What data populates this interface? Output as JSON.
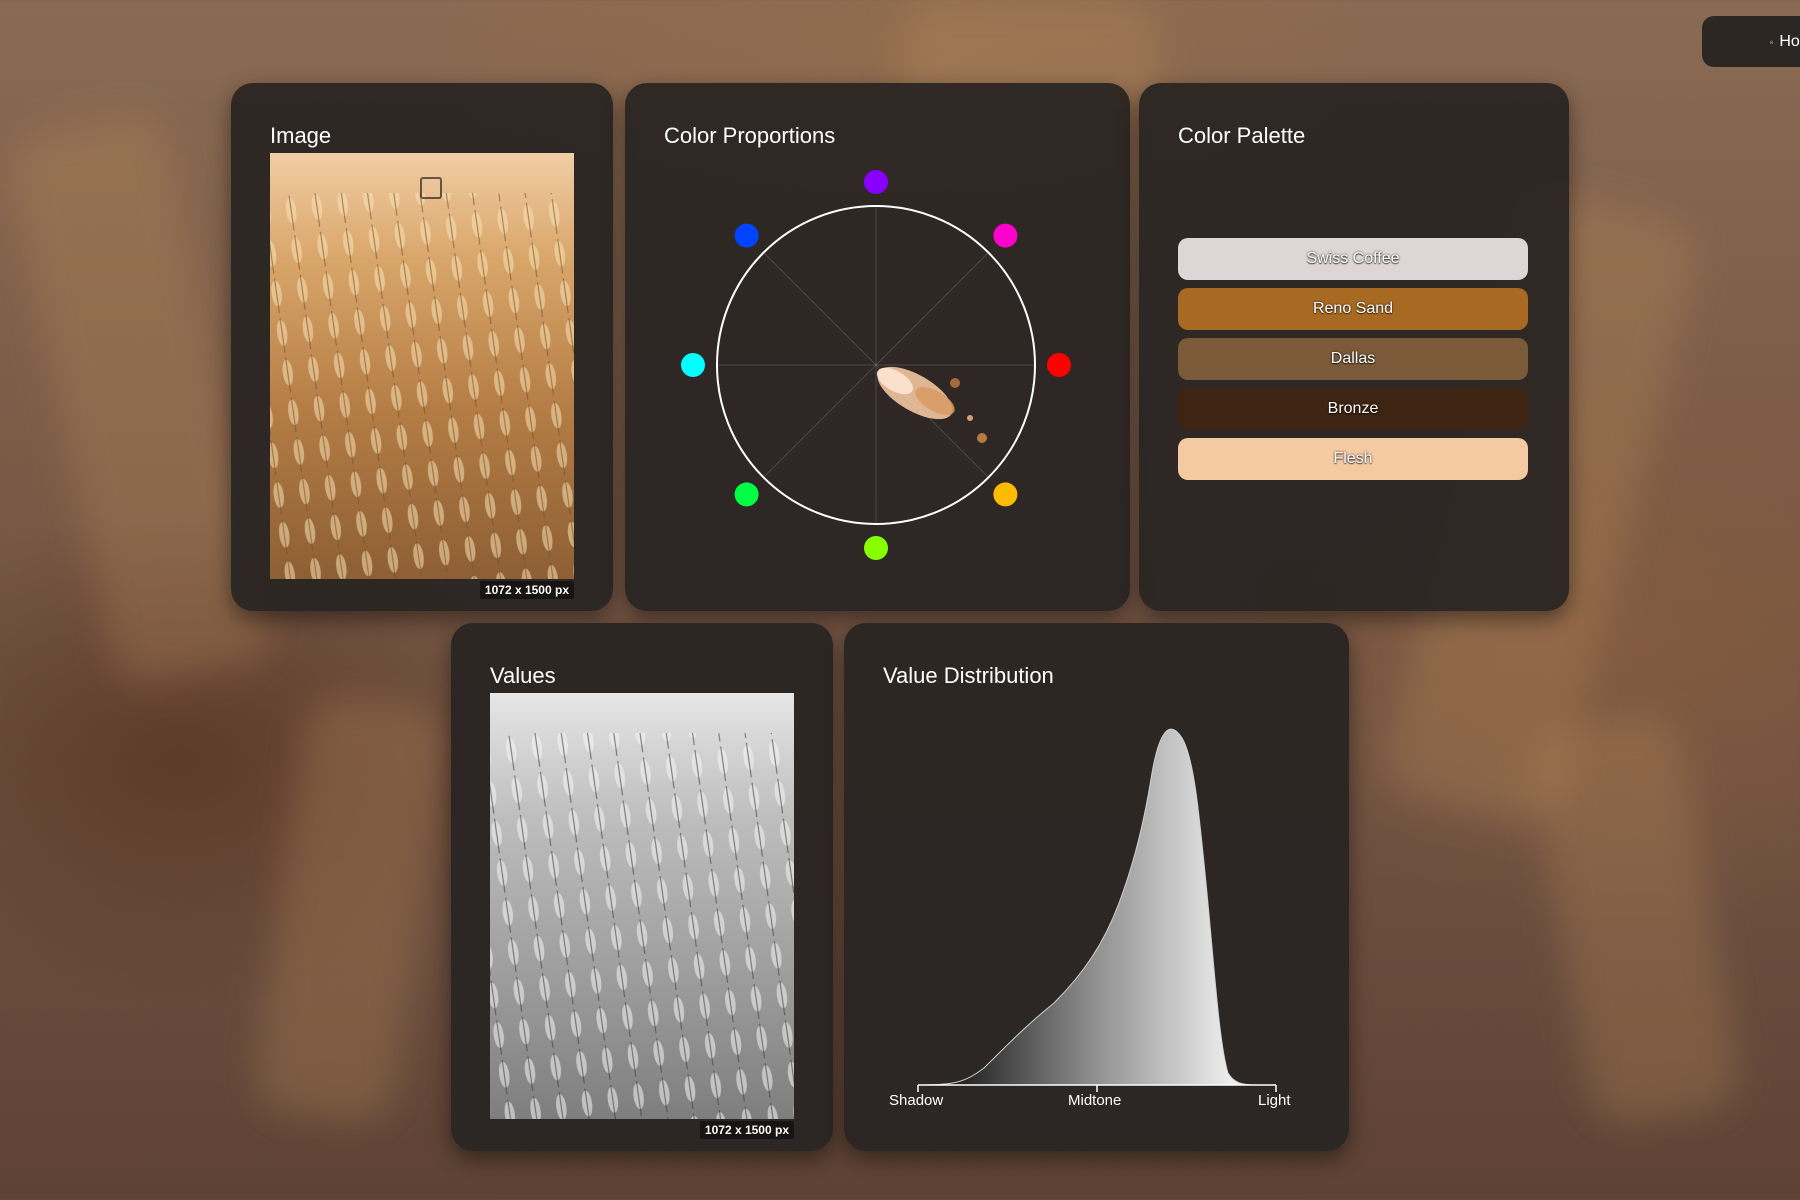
{
  "nav": {
    "home_label": "Home"
  },
  "image_card": {
    "title": "Image",
    "dimensions": "1072 x 1500 px"
  },
  "proportions_card": {
    "title": "Color Proportions",
    "hue_markers": [
      {
        "name": "violet",
        "color": "#8800ff"
      },
      {
        "name": "magenta",
        "color": "#ff00cc"
      },
      {
        "name": "red",
        "color": "#ff0000"
      },
      {
        "name": "orange",
        "color": "#ffbb00"
      },
      {
        "name": "yellow-green",
        "color": "#88ff00"
      },
      {
        "name": "green",
        "color": "#00ff44"
      },
      {
        "name": "cyan",
        "color": "#00ffff"
      },
      {
        "name": "blue",
        "color": "#0044ff"
      }
    ]
  },
  "palette_card": {
    "title": "Color Palette",
    "colors": [
      {
        "name": "Swiss Coffee",
        "hex": "#ddd5d6"
      },
      {
        "name": "Reno Sand",
        "hex": "#a86a22"
      },
      {
        "name": "Dallas",
        "hex": "#7a5a38"
      },
      {
        "name": "Bronze",
        "hex": "#3e2412"
      },
      {
        "name": "Flesh",
        "hex": "#f5c9a2"
      }
    ]
  },
  "values_card": {
    "title": "Values",
    "dimensions": "1072 x 1500 px"
  },
  "distribution_card": {
    "title": "Value Distribution",
    "axis_labels": {
      "shadow": "Shadow",
      "midtone": "Midtone",
      "light": "Light"
    }
  }
}
